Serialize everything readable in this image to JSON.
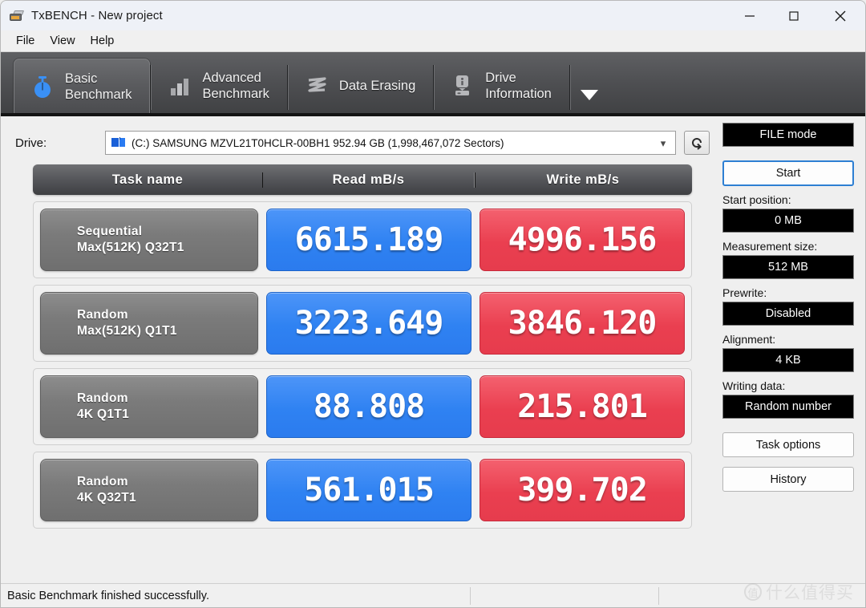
{
  "window": {
    "title": "TxBENCH - New project",
    "app_icon": "txbench-app-icon",
    "minimize": "minimize-icon",
    "maximize": "maximize-icon",
    "close": "close-icon"
  },
  "menu": {
    "items": [
      {
        "label": "File"
      },
      {
        "label": "View"
      },
      {
        "label": "Help"
      }
    ]
  },
  "tabs": {
    "items": [
      {
        "label": "Basic\nBenchmark",
        "icon": "stopwatch-icon",
        "active": true
      },
      {
        "label": "Advanced\nBenchmark",
        "icon": "bar-chart-icon",
        "active": false
      },
      {
        "label": "Data Erasing",
        "icon": "eraser-icon",
        "active": false
      },
      {
        "label": "Drive\nInformation",
        "icon": "drive-info-icon",
        "active": false
      }
    ],
    "overflow_icon": "chevron-down-icon"
  },
  "drive": {
    "label": "Drive:",
    "value": "(C:) SAMSUNG MZVL21T0HCLR-00BH1  952.94 GB (1,998,467,072 Sectors)",
    "caret_icon": "chevron-down-icon",
    "refresh_icon": "refresh-icon"
  },
  "table": {
    "headers": {
      "task": "Task name",
      "read": "Read mB/s",
      "write": "Write mB/s"
    },
    "rows": [
      {
        "task_line1": "Sequential",
        "task_line2": "Max(512K) Q32T1",
        "read": "6615.189",
        "write": "4996.156"
      },
      {
        "task_line1": "Random",
        "task_line2": "Max(512K) Q1T1",
        "read": "3223.649",
        "write": "3846.120"
      },
      {
        "task_line1": "Random",
        "task_line2": "4K Q1T1",
        "read": "88.808",
        "write": "215.801"
      },
      {
        "task_line1": "Random",
        "task_line2": "4K Q32T1",
        "read": "561.015",
        "write": "399.702"
      }
    ]
  },
  "sidebar": {
    "mode": "FILE mode",
    "start_button": "Start",
    "start_position_label": "Start position:",
    "start_position_value": "0 MB",
    "measurement_size_label": "Measurement size:",
    "measurement_size_value": "512 MB",
    "prewrite_label": "Prewrite:",
    "prewrite_value": "Disabled",
    "alignment_label": "Alignment:",
    "alignment_value": "4 KB",
    "writing_data_label": "Writing data:",
    "writing_data_value": "Random number",
    "task_options": "Task options",
    "history": "History"
  },
  "statusbar": {
    "message": "Basic Benchmark finished successfully."
  },
  "watermark": {
    "mark": "值",
    "text": "什么值得买"
  },
  "colors": {
    "read_blue": "#2f82f2",
    "write_red": "#ea3f50",
    "tab_dark": "#4e4f52",
    "accent": "#2d7fd3"
  },
  "chart_data": {
    "type": "table",
    "title": "TxBENCH Basic Benchmark results",
    "categories": [
      "Sequential Max(512K) Q32T1",
      "Random Max(512K) Q1T1",
      "Random 4K Q1T1",
      "Random 4K Q32T1"
    ],
    "series": [
      {
        "name": "Read mB/s",
        "values": [
          6615.189,
          3223.649,
          88.808,
          561.015
        ]
      },
      {
        "name": "Write mB/s",
        "values": [
          4996.156,
          3846.12,
          215.801,
          399.702
        ]
      }
    ],
    "xlabel": "Task name",
    "ylabel": "mB/s"
  }
}
